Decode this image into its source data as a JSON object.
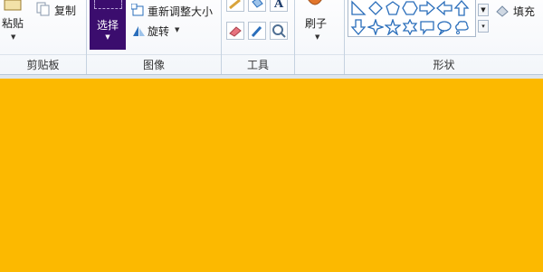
{
  "clipboard": {
    "paste_label": "粘贴",
    "copy_label": "复制",
    "group_label": "剪贴板"
  },
  "image": {
    "select_label": "选择",
    "resize_label": "重新调整大小",
    "rotate_label": "旋转",
    "group_label": "图像"
  },
  "tools": {
    "group_label": "工具"
  },
  "brushes": {
    "label": "刷子"
  },
  "shapes": {
    "group_label": "形状",
    "fill_label": "填充",
    "items": [
      "triangle-right",
      "diamond",
      "pentagon",
      "hexagon",
      "arrow-right",
      "arrow-left",
      "arrow-up",
      "arrow-down",
      "star-4",
      "star-5",
      "star-6",
      "callout-rect",
      "callout-oval",
      "callout-cloud"
    ]
  },
  "colors": {
    "canvas": "#fcb900",
    "select_active": "#3b0d6e",
    "accent_blue": "#2a6ebb"
  }
}
